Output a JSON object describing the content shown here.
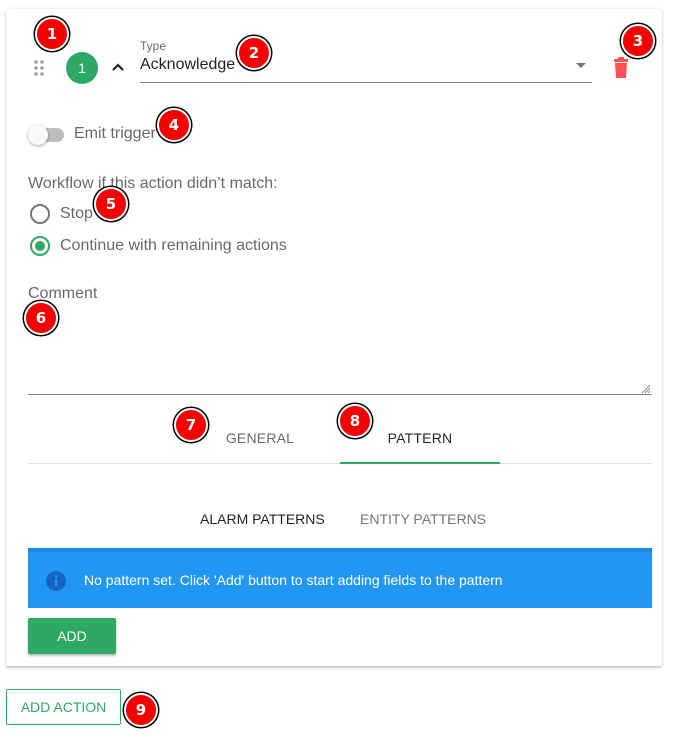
{
  "action_card": {
    "step_number": "1",
    "type_field": {
      "label": "Type",
      "value": "Acknowledge"
    },
    "emit_trigger": {
      "label": "Emit trigger",
      "enabled": false
    },
    "workflow": {
      "label": "Workflow if this action didn’t match:",
      "options": [
        {
          "label": "Stop",
          "selected": false
        },
        {
          "label": "Continue with remaining actions",
          "selected": true
        }
      ]
    },
    "comment": {
      "label": "Comment",
      "value": ""
    },
    "tabs": [
      {
        "label": "GENERAL",
        "active": false
      },
      {
        "label": "PATTERN",
        "active": true
      }
    ],
    "pattern_subtabs": [
      {
        "label": "ALARM PATTERNS",
        "active": true
      },
      {
        "label": "ENTITY PATTERNS",
        "active": false
      }
    ],
    "info_alert": {
      "icon": "info-icon",
      "text": "No pattern set. Click 'Add' button to start adding fields to the pattern"
    },
    "add_button_label": "ADD"
  },
  "add_action_label": "ADD ACTION",
  "annotations": [
    "1",
    "2",
    "3",
    "4",
    "5",
    "6",
    "7",
    "8",
    "9"
  ],
  "colors": {
    "accent": "#2ea965",
    "delete": "#ff5252",
    "info": "#2196f3",
    "marker": "#f50000"
  },
  "icons": {
    "drag": "drag-handle-icon",
    "collapse": "chevron-up-icon",
    "dropdown": "caret-down-icon",
    "delete": "trash-icon"
  }
}
